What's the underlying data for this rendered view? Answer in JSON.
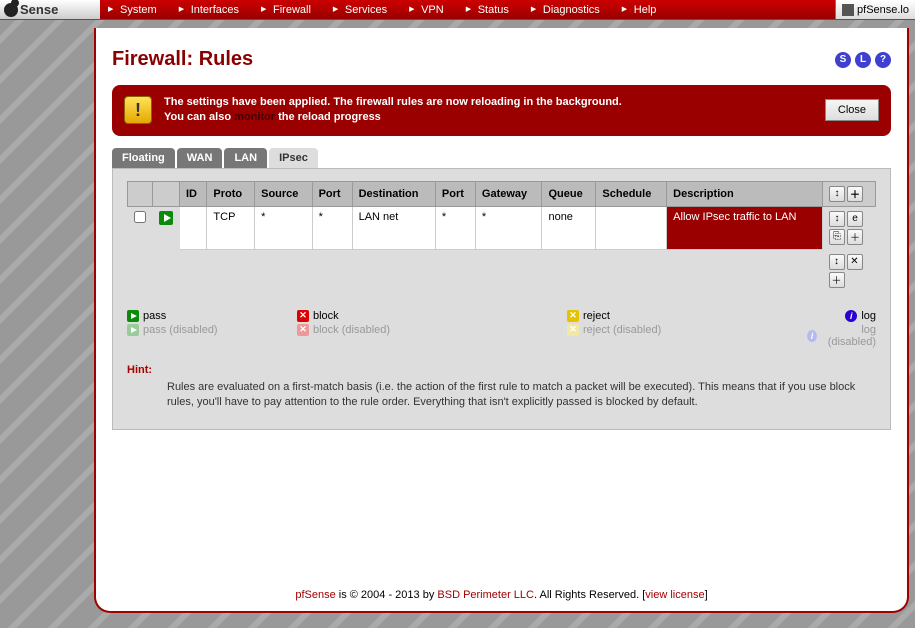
{
  "logo": "Sense",
  "nav": [
    "System",
    "Interfaces",
    "Firewall",
    "Services",
    "VPN",
    "Status",
    "Diagnostics",
    "Help"
  ],
  "right_tab": "pfSense.lo",
  "page_title": "Firewall: Rules",
  "help_icons": [
    "S",
    "L",
    "?"
  ],
  "alert": {
    "line1": "The settings have been applied. The firewall rules are now reloading in the background.",
    "line2_a": "You can also ",
    "line2_link": "monitor",
    "line2_b": " the reload progress",
    "close": "Close"
  },
  "tabs": [
    "Floating",
    "WAN",
    "LAN",
    "IPsec"
  ],
  "active_tab": 3,
  "headers": [
    "ID",
    "Proto",
    "Source",
    "Port",
    "Destination",
    "Port",
    "Gateway",
    "Queue",
    "Schedule",
    "Description"
  ],
  "rows": [
    {
      "id": "",
      "proto": "TCP",
      "source": "*",
      "sport": "*",
      "dest": "LAN net",
      "dport": "*",
      "gateway": "*",
      "queue": "none",
      "schedule": "",
      "desc": "Allow IPsec traffic to LAN"
    }
  ],
  "legend": {
    "pass": "pass",
    "pass_d": "pass (disabled)",
    "block": "block",
    "block_d": "block (disabled)",
    "reject": "reject",
    "reject_d": "reject (disabled)",
    "log": "log",
    "log_d": "log (disabled)"
  },
  "hint_label": "Hint:",
  "hint_body": "Rules are evaluated on a first-match basis (i.e. the action of the first rule to match a packet will be executed). This means that if you use block rules, you'll have to pay attention to the rule order. Everything that isn't explicitly passed is blocked by default.",
  "footer": {
    "a": "pfSense",
    "b": " is © 2004 - 2013 by ",
    "c": "BSD Perimeter LLC",
    "d": ". All Rights Reserved. [",
    "e": "view license",
    "f": "]"
  }
}
